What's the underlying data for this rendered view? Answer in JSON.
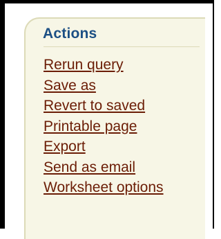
{
  "actions": {
    "title": "Actions",
    "links": [
      "Rerun query",
      "Save as",
      "Revert to saved",
      "Printable page",
      "Export",
      "Send as email",
      "Worksheet options"
    ]
  },
  "colors": {
    "title": "#1c4f84",
    "link": "#6b1d06",
    "panel_bg": "#f7f6e6",
    "panel_border": "#dcdab7"
  }
}
